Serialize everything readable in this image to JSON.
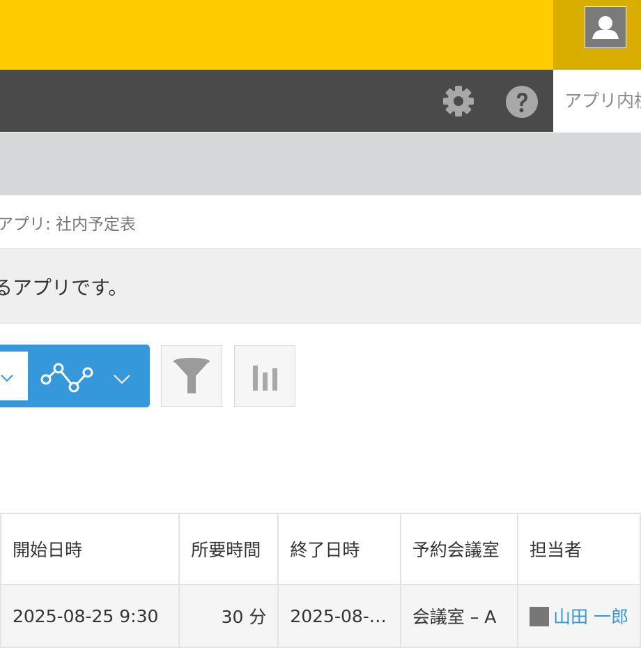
{
  "header": {
    "search_placeholder": "アプリ内検索"
  },
  "icons": {
    "avatar": "user-silhouette-icon",
    "settings": "gear-icon",
    "help": "question-circle-icon",
    "chart_view": "line-chart-icon",
    "filter": "funnel-icon",
    "graph": "bar-chart-icon",
    "dropdown": "chevron-down-icon"
  },
  "colors": {
    "header_bg": "#ffcc00",
    "user_area_bg": "#d9ad00",
    "nav_bg": "#4a4a4a",
    "accent": "#3498db"
  },
  "breadcrumb": {
    "text": "アプリ: 社内予定表"
  },
  "app": {
    "description": "るアプリです。"
  },
  "table": {
    "headers": [
      "開始日時",
      "所要時間",
      "終了日時",
      "予約会議室",
      "担当者"
    ],
    "rows": [
      {
        "start": "2025-08-25 9:30",
        "duration": "30 分",
        "end": "2025-08-…",
        "room": "会議室 – A",
        "owner": "山田 一郎"
      }
    ]
  }
}
